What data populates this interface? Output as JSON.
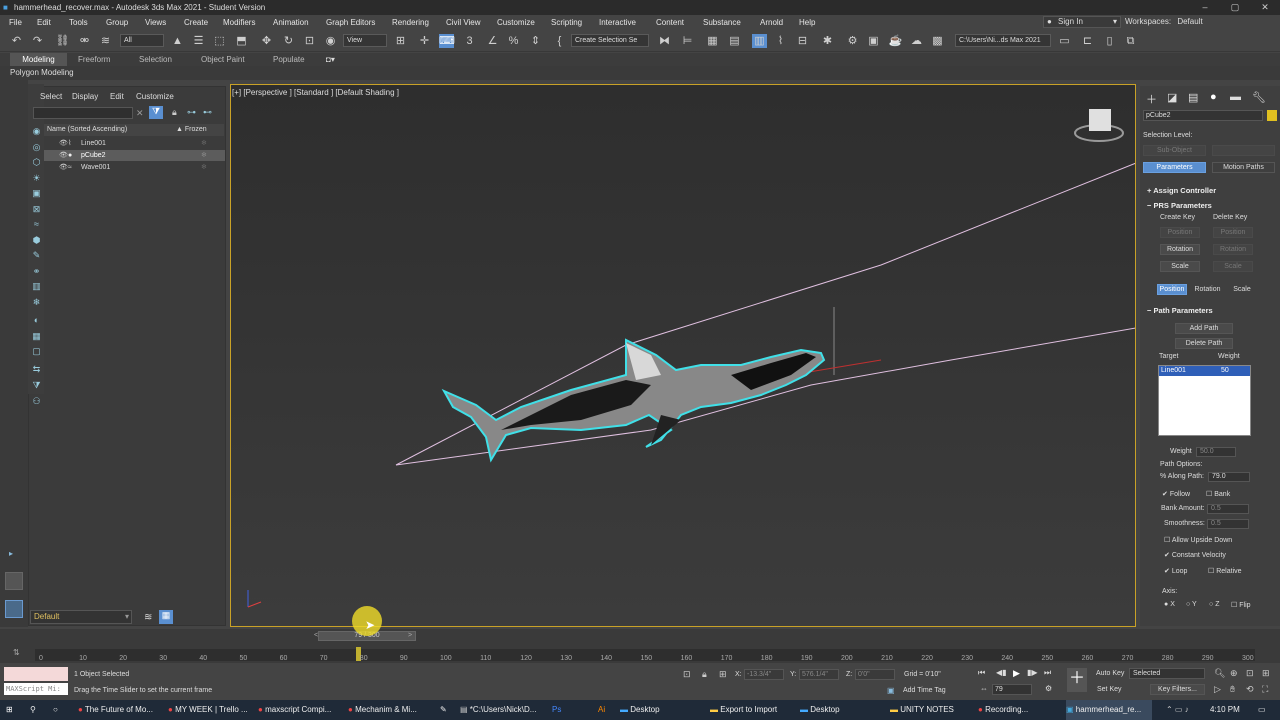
{
  "window": {
    "title": "hammerhead_recover.max - Autodesk 3ds Max 2021 - Student Version"
  },
  "menu": [
    "File",
    "Edit",
    "Tools",
    "Group",
    "Views",
    "Create",
    "Modifiers",
    "Animation",
    "Graph Editors",
    "Rendering",
    "Civil View",
    "Customize",
    "Scripting",
    "Interactive",
    "Content",
    "Substance",
    "Arnold",
    "Help"
  ],
  "signin": "Sign In",
  "workspace": {
    "label": "Workspaces:",
    "value": "Default"
  },
  "toolbar": {
    "filter": "All",
    "refcoord": "View",
    "selset": "Create Selection Se",
    "path": "C:\\Users\\Ni...ds Max 2021"
  },
  "ribbon": {
    "tabs": [
      "Modeling",
      "Freeform",
      "Selection",
      "Object Paint",
      "Populate"
    ],
    "sub": "Polygon Modeling"
  },
  "scene": {
    "menu": [
      "Select",
      "Display",
      "Edit",
      "Customize"
    ],
    "col_name": "Name (Sorted Ascending)",
    "col_frozen": "▲ Frozen",
    "rows": [
      "Line001",
      "pCube2",
      "Wave001"
    ]
  },
  "viewport": {
    "label": "[+] [Perspective ] [Standard ] [Default Shading ]"
  },
  "cmd": {
    "object_name": "pCube2",
    "selection_level": "Selection Level:",
    "sub_object": "Sub-Object",
    "parameters": "Parameters",
    "motion_paths": "Motion Paths",
    "assign_controller": "Assign Controller",
    "prs": "PRS Parameters",
    "create_key": "Create Key",
    "delete_key": "Delete Key",
    "position": "Position",
    "rotation": "Rotation",
    "scale": "Scale",
    "path_params": "Path Parameters",
    "add_path": "Add Path",
    "delete_path": "Delete Path",
    "target": "Target",
    "weight": "Weight",
    "target_name": "Line001",
    "target_weight": "50",
    "weight_label": "Weight",
    "weight_value": "50.0",
    "path_options": "Path Options:",
    "along_path": "% Along Path:",
    "along_value": "79.0",
    "follow": "Follow",
    "bank": "Bank",
    "bank_amount": "Bank Amount:",
    "bank_value": "0.5",
    "smoothness": "Smoothness:",
    "smooth_value": "0.5",
    "allow_upside": "Allow Upside Down",
    "const_velocity": "Constant Velocity",
    "loop": "Loop",
    "relative": "Relative",
    "axis": "Axis:",
    "axes": [
      "X",
      "Y",
      "Z"
    ],
    "flip": "Flip"
  },
  "layer": "Default",
  "timeline": {
    "slider": "79 / 300",
    "ticks": [
      "0",
      "10",
      "20",
      "30",
      "40",
      "50",
      "60",
      "70",
      "80",
      "90",
      "100",
      "110",
      "120",
      "130",
      "140",
      "150",
      "160",
      "170",
      "180",
      "190",
      "200",
      "210",
      "220",
      "230",
      "240",
      "250",
      "260",
      "270",
      "280",
      "290",
      "300"
    ]
  },
  "status": {
    "maxscript": "MAXScript Mi:",
    "selected": "1 Object Selected",
    "hint": "Drag the Time Slider to set the current frame",
    "x_label": "X:",
    "x_val": "-13.3/4\"",
    "y_label": "Y:",
    "y_val": "576.1/4\"",
    "z_label": "Z:",
    "z_val": "0'0\"",
    "grid": "Grid = 0'10\"",
    "add_time_tag": "Add Time Tag",
    "auto_key": "Auto Key",
    "set_key": "Set Key",
    "selected_dd": "Selected",
    "key_filters": "Key Filters...",
    "frame": "79"
  },
  "taskbar": {
    "items": [
      "The Future of Mo...",
      "MY WEEK | Trello ...",
      "maxscript Compi...",
      "Mechanim & Mi...",
      "*C:\\Users\\Nick\\D...",
      "Desktop",
      "Export to Import",
      "Desktop",
      "UNITY NOTES",
      "Recording...",
      "hammerhead_re..."
    ],
    "clock": "4:10 PM"
  }
}
